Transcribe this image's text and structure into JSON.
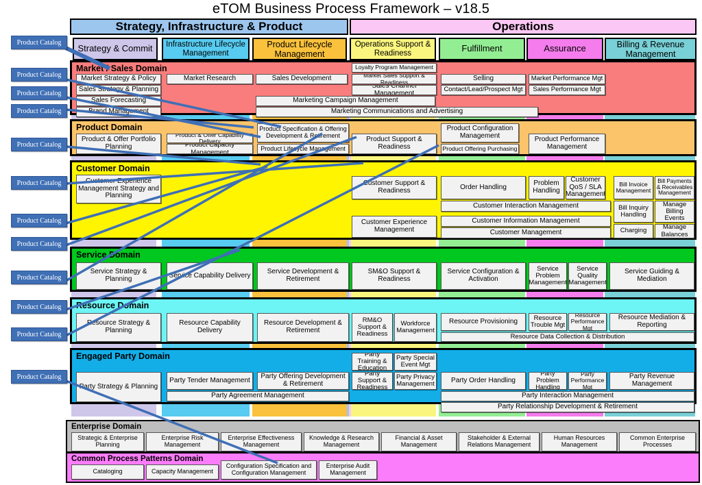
{
  "title": "eTOM Business Process Framework – v18.5",
  "colors": {
    "sip_header": "#9DC6EE",
    "ops_header": "#FBC7F4",
    "strategy_commit": "#CFC7EA",
    "infrastructure_lifecycle": "#57CBF0",
    "product_lifecycle": "#F9C13C",
    "operations_support": "#FAF57E",
    "fulfillment": "#93EE93",
    "assurance": "#F47CEC",
    "billing_revenue": "#79D0D6",
    "market_sales_domain": "#FA7D7D",
    "product_domain": "#FBC46A",
    "customer_domain": "#FFF500",
    "service_domain": "#00C81E",
    "resource_domain": "#6DF4F4",
    "engaged_party_domain": "#13AEE8",
    "enterprise_domain": "#BEBEBE",
    "common_process_domain": "#FB7DFB",
    "callout": "#3F6FB5",
    "box_fill": "#F2F2F2"
  },
  "header": {
    "groups": [
      {
        "label": "Strategy, Infrastructure & Product"
      },
      {
        "label": "Operations"
      }
    ],
    "columns": [
      {
        "label": "Strategy & Commit"
      },
      {
        "label": "Infrastructure Lifecycle Management"
      },
      {
        "label": "Product Lifecycle Management"
      },
      {
        "label": "Operations Support & Readiness"
      },
      {
        "label": "Fulfillment"
      },
      {
        "label": "Assurance"
      },
      {
        "label": "Billing & Revenue Management"
      }
    ]
  },
  "callouts": [
    {
      "label": "Product Catalog"
    },
    {
      "label": "Product Catalog"
    },
    {
      "label": "Product Catalog"
    },
    {
      "label": "Product Catalog"
    },
    {
      "label": "Product Catalog"
    },
    {
      "label": "Product Catalog"
    },
    {
      "label": "Product Catalog"
    },
    {
      "label": "Product Catalog"
    },
    {
      "label": "Product Catalog"
    },
    {
      "label": "Product Catalog"
    },
    {
      "label": "Product Catalog"
    }
  ],
  "domains": [
    {
      "name": "Market / Sales Domain",
      "boxes": [
        {
          "label": "Market Strategy & Policy"
        },
        {
          "label": "Sales Strategy & Planning"
        },
        {
          "label": "Sales Forecasting"
        },
        {
          "label": "Brand Management"
        },
        {
          "label": "Market Research"
        },
        {
          "label": "Sales Development"
        },
        {
          "label": "Marketing Campaign Management"
        },
        {
          "label": "Marketing Communications and Advertising"
        },
        {
          "label": "Loyalty Program Management"
        },
        {
          "label": "Market Sales Support & Readiness"
        },
        {
          "label": "Sales Channel Management"
        },
        {
          "label": "Selling"
        },
        {
          "label": "Contact/Lead/Prospect Mgt"
        },
        {
          "label": "Market Performance Mgt"
        },
        {
          "label": "Sales Performance Mgt"
        }
      ]
    },
    {
      "name": "Product Domain",
      "boxes": [
        {
          "label": "Product & Offer Portfolio Planning"
        },
        {
          "label": "Product & Offer Capability Delivery"
        },
        {
          "label": "Product Capacity Management"
        },
        {
          "label": "Product Specification & Offering Development & Retirement"
        },
        {
          "label": "Product Lifecycle Management"
        },
        {
          "label": "Product Support & Readiness"
        },
        {
          "label": "Product Configuration Management"
        },
        {
          "label": "Product Offering Purchasing"
        },
        {
          "label": "Product Performance Management"
        }
      ]
    },
    {
      "name": "Customer Domain",
      "boxes": [
        {
          "label": "Customer Experience Management Strategy and Planning"
        },
        {
          "label": "Customer Support & Readiness"
        },
        {
          "label": "Customer Experience Management"
        },
        {
          "label": "Order Handling"
        },
        {
          "label": "Problem Handling"
        },
        {
          "label": "Customer QoS / SLA Management"
        },
        {
          "label": "Customer Interaction Management"
        },
        {
          "label": "Customer Information Management"
        },
        {
          "label": "Customer Management"
        },
        {
          "label": "Bill Invoice Management"
        },
        {
          "label": "Bill Inquiry Handling"
        },
        {
          "label": "Charging"
        },
        {
          "label": "Bill Payments & Receivables Management"
        },
        {
          "label": "Manage Billing Events"
        },
        {
          "label": "Manage Balances"
        }
      ]
    },
    {
      "name": "Service Domain",
      "boxes": [
        {
          "label": "Service Strategy & Planning"
        },
        {
          "label": "Service Capability Delivery"
        },
        {
          "label": "Service Development & Retirement"
        },
        {
          "label": "SM&O Support & Readiness"
        },
        {
          "label": "Service Configuration & Activation"
        },
        {
          "label": "Service Problem Management"
        },
        {
          "label": "Service Quality Management"
        },
        {
          "label": "Service Guiding & Mediation"
        }
      ]
    },
    {
      "name": "Resource Domain",
      "boxes": [
        {
          "label": "Resource Strategy & Planning"
        },
        {
          "label": "Resource Capability Delivery"
        },
        {
          "label": "Resource  Development & Retirement"
        },
        {
          "label": "RM&O Support & Readiness"
        },
        {
          "label": "Workforce Management"
        },
        {
          "label": "Resource Provisioning"
        },
        {
          "label": "Resource Trouble Mgt"
        },
        {
          "label": "Resource Performance Mgt"
        },
        {
          "label": "Resource Mediation & Reporting"
        },
        {
          "label": "Resource Data Collection & Distribution"
        }
      ]
    },
    {
      "name": "Engaged Party Domain",
      "boxes": [
        {
          "label": "Party Strategy & Planning"
        },
        {
          "label": "Party Tender Management"
        },
        {
          "label": "Party Offering Development & Retirement"
        },
        {
          "label": "Party Agreement Management"
        },
        {
          "label": "Party Training & Education"
        },
        {
          "label": "Party Support & Readiness"
        },
        {
          "label": "Party Special Event Mgt"
        },
        {
          "label": "Party Privacy Management"
        },
        {
          "label": "Party Order Handling"
        },
        {
          "label": "Party Problem Handling"
        },
        {
          "label": "Party Performance Mgt"
        },
        {
          "label": "Party Revenue Management"
        },
        {
          "label": "Party Interaction Management"
        },
        {
          "label": "Party Relationship Development & Retirement"
        }
      ]
    }
  ],
  "enterprise": {
    "name": "Enterprise Domain",
    "boxes": [
      {
        "label": "Strategic & Enterprise Planning"
      },
      {
        "label": "Enterprise Risk Management"
      },
      {
        "label": "Enterprise Effectiveness Management"
      },
      {
        "label": "Knowledge & Research Management"
      },
      {
        "label": "Financial & Asset Management"
      },
      {
        "label": "Stakeholder & External Relations Management"
      },
      {
        "label": "Human Resources Management"
      },
      {
        "label": "Common Enterprise Processes"
      }
    ]
  },
  "common_patterns": {
    "name": "Common Process Patterns Domain",
    "boxes": [
      {
        "label": "Cataloging"
      },
      {
        "label": "Capacity Management"
      },
      {
        "label": "Configuration Specification and Configuration Management"
      },
      {
        "label": "Enterprise Audit Management"
      }
    ]
  }
}
